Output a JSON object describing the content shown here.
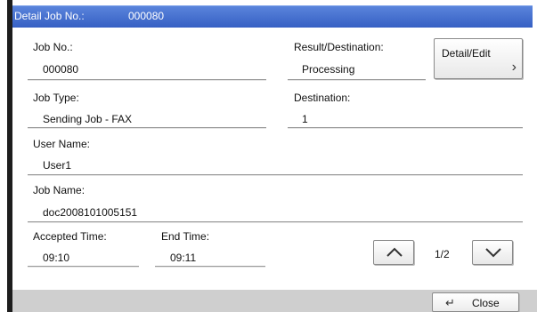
{
  "title": {
    "label": "Detail Job No.:",
    "value": "000080"
  },
  "fields": {
    "job_no": {
      "label": "Job No.:",
      "value": "000080"
    },
    "result_destination": {
      "label": "Result/Destination:",
      "value": "Processing"
    },
    "job_type": {
      "label": "Job Type:",
      "value": "Sending Job - FAX"
    },
    "destination": {
      "label": "Destination:",
      "value": "1"
    },
    "user_name": {
      "label": "User Name:",
      "value": "User1"
    },
    "job_name": {
      "label": "Job Name:",
      "value": "doc2008101005151"
    },
    "accepted_time": {
      "label": "Accepted Time:",
      "value": "09:10"
    },
    "end_time": {
      "label": "End Time:",
      "value": "09:11"
    }
  },
  "buttons": {
    "detail_edit": "Detail/Edit",
    "close": "Close"
  },
  "pagination": {
    "text": "1/2"
  },
  "icons": {
    "detail": "chevron-right-icon",
    "up": "chevron-up-icon",
    "down": "chevron-down-icon",
    "close": "return-arrow-icon"
  },
  "colors": {
    "title_bar": "#4a74d4",
    "bottom_bar": "#cfcfcf"
  }
}
